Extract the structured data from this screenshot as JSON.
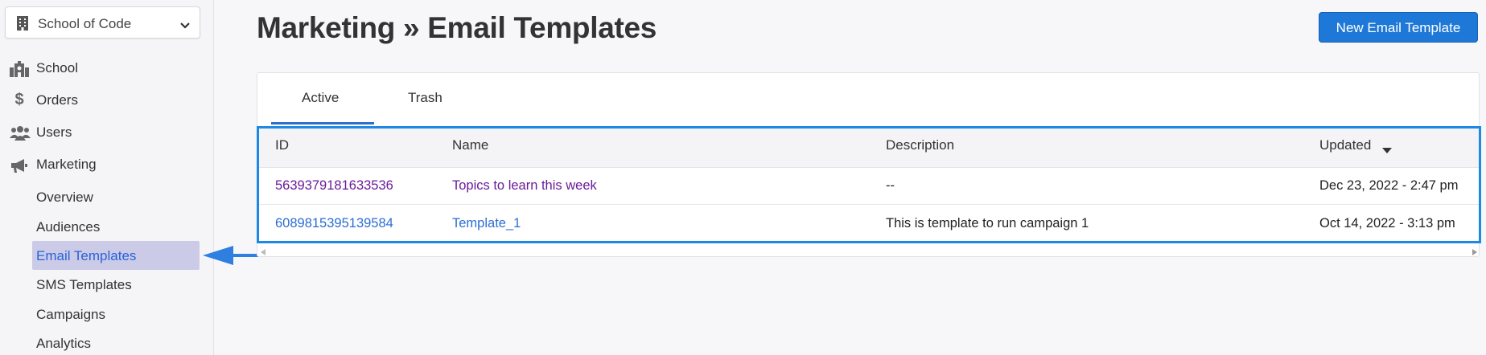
{
  "sidebar": {
    "school_selector": {
      "value": "School of Code"
    },
    "items": [
      {
        "label": "School",
        "icon": "school-icon"
      },
      {
        "label": "Orders",
        "icon": "dollar-icon"
      },
      {
        "label": "Users",
        "icon": "users-icon"
      },
      {
        "label": "Marketing",
        "icon": "megaphone-icon"
      }
    ],
    "marketing_sub": [
      "Overview",
      "Audiences",
      "Email Templates",
      "SMS Templates",
      "Campaigns",
      "Analytics"
    ],
    "active_sub": "Email Templates"
  },
  "header": {
    "title": "Marketing » Email Templates",
    "new_button": "New Email Template"
  },
  "tabs": [
    {
      "label": "Active",
      "active": true
    },
    {
      "label": "Trash",
      "active": false
    }
  ],
  "table": {
    "columns": [
      "ID",
      "Name",
      "Description",
      "Updated"
    ],
    "sorted_column": "Updated",
    "sort_direction": "desc",
    "rows": [
      {
        "id": "5639379181633536",
        "name": "Topics to learn this week",
        "description": "--",
        "updated": "Dec 23, 2022 - 2:47 pm"
      },
      {
        "id": "6089815395139584",
        "name": "Template_1",
        "description": "This is template to run campaign 1",
        "updated": "Oct 14, 2022 - 3:13 pm"
      }
    ]
  },
  "colors": {
    "accent": "#1e78d7",
    "highlight_box": "#1e88e5",
    "active_nav_bg": "#cbcbe8",
    "visited_link": "#6a1b9a",
    "link": "#2a6ed4"
  }
}
